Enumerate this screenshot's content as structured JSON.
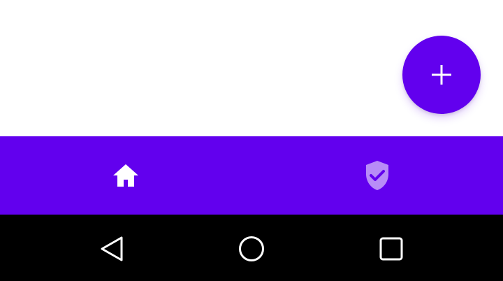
{
  "fab": {
    "icon": "plus-icon",
    "color": "#6200ee"
  },
  "bottom_nav": {
    "color": "#6200ee",
    "items": [
      {
        "icon": "home-icon",
        "selected": true
      },
      {
        "icon": "verified-shield-icon",
        "selected": false
      }
    ]
  },
  "system_nav": {
    "buttons": [
      {
        "icon": "back-triangle-icon"
      },
      {
        "icon": "home-circle-icon"
      },
      {
        "icon": "recents-square-icon"
      }
    ]
  }
}
